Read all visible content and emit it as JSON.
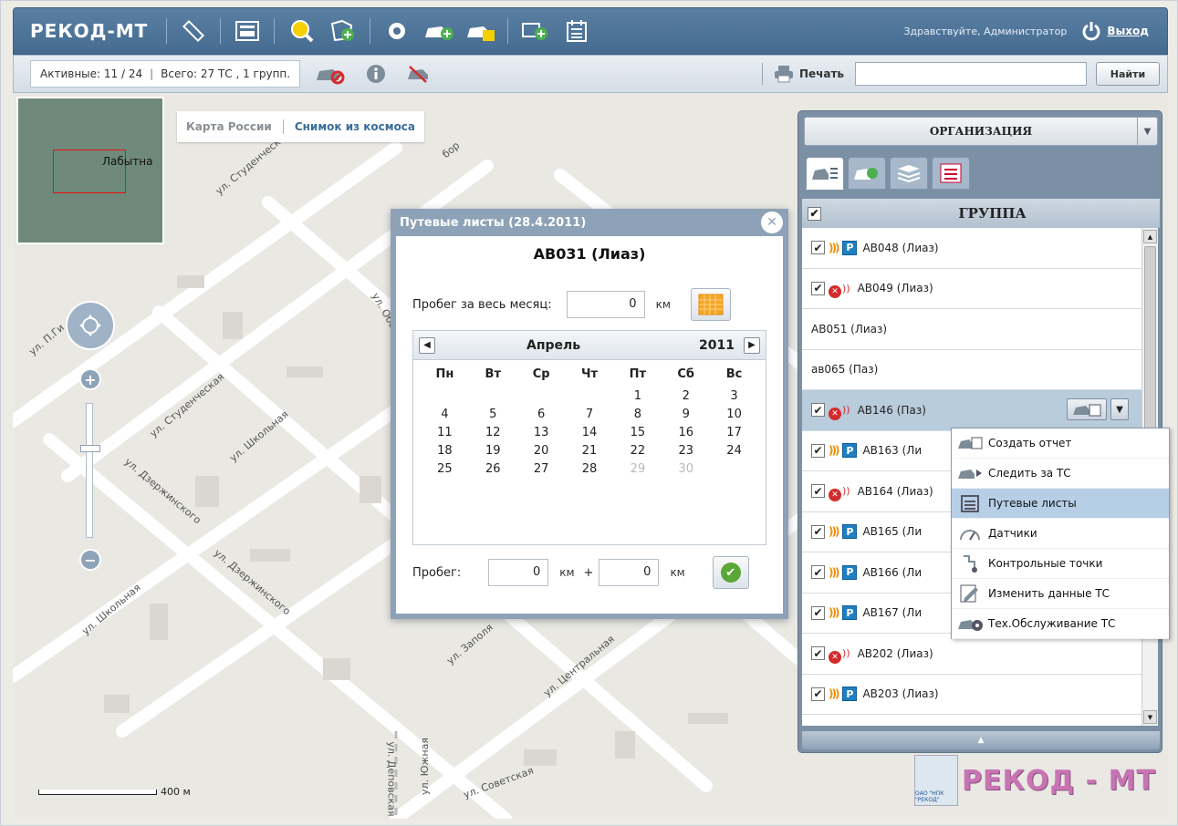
{
  "app": {
    "logo": "РЕКОД-МТ",
    "greeting": "Здравствуйте, Администратор",
    "exit_label": "Выход"
  },
  "topbar_icons": [
    "ruler-icon",
    "calculator-icon",
    "zoom-search-icon",
    "add-zone-icon",
    "gear-icon",
    "add-vehicle-icon",
    "vehicle-report-icon",
    "add-card-icon",
    "calendar-list-icon"
  ],
  "stats": {
    "active": "Активные: 11 / 24",
    "total": "Всего: 27 ТС , 1 групп."
  },
  "toolbar": {
    "print_label": "Печать",
    "search_value": "",
    "find_label": "Найти"
  },
  "map": {
    "tab_russia": "Карта России",
    "tab_space": "Снимок из космоса",
    "minimap_label": "Лабытна",
    "scale_label": "400 м",
    "streets": [
      "ул. Студенческая",
      "ул. Студенческая",
      "ул. Школьная",
      "ул. Дзержинского",
      "ул. Дзержинского",
      "ул. Школьная",
      "ул. П.Ги",
      "ул. Южная",
      "ул. Деповская",
      "ул. Советская",
      "ул. Центральная",
      "ул. Заполя",
      "ул. Обс",
      "бор"
    ]
  },
  "dialog": {
    "header": "Путевые листы (28.4.2011)",
    "vehicle": "АВ031 (Лиаз)",
    "month_label": "Пробег за весь месяц:",
    "month_value": "0",
    "unit": "км",
    "cal_month": "Апрель",
    "cal_year": "2011",
    "weekdays": [
      "Пн",
      "Вт",
      "Ср",
      "Чт",
      "Пт",
      "Сб",
      "Вс"
    ],
    "weeks": [
      [
        "",
        "",
        "",
        "",
        "1",
        "2",
        "3"
      ],
      [
        "4",
        "5",
        "6",
        "7",
        "8",
        "9",
        "10"
      ],
      [
        "11",
        "12",
        "13",
        "14",
        "15",
        "16",
        "17"
      ],
      [
        "18",
        "19",
        "20",
        "21",
        "22",
        "23",
        "24"
      ],
      [
        "25",
        "26",
        "27",
        "28",
        "29",
        "30",
        ""
      ]
    ],
    "disabled_days": [
      "29",
      "30"
    ],
    "mileage_label": "Пробег:",
    "mileage_value": "0",
    "mileage_extra": "0",
    "plus": "+"
  },
  "panel": {
    "org_label": "ОРГАНИЗАЦИЯ",
    "tabs": [
      "vehicle-list-icon",
      "vehicle-key-icon",
      "layers-icon",
      "checklist-icon"
    ],
    "group_label": "ГРУППА",
    "vehicles": [
      {
        "name": "АВ048 (Лиаз)",
        "cb": true,
        "status": "online",
        "parking": true
      },
      {
        "name": "АВ049 (Лиаз)",
        "cb": true,
        "status": "offline",
        "parking": false
      },
      {
        "name": "АВ051 (Лиаз)",
        "cb": false,
        "status": "none",
        "parking": false
      },
      {
        "name": "ав065 (Паз)",
        "cb": false,
        "status": "none",
        "parking": false
      },
      {
        "name": "АВ146 (Паз)",
        "cb": true,
        "status": "offline",
        "parking": false,
        "selected": true
      },
      {
        "name": "АВ163 (Ли",
        "cb": true,
        "status": "online",
        "parking": true
      },
      {
        "name": "АВ164 (Лиаз)",
        "cb": true,
        "status": "offline",
        "parking": false
      },
      {
        "name": "АВ165 (Ли",
        "cb": true,
        "status": "online",
        "parking": true
      },
      {
        "name": "АВ166 (Ли",
        "cb": true,
        "status": "online",
        "parking": true
      },
      {
        "name": "АВ167 (Ли",
        "cb": true,
        "status": "online",
        "parking": true
      },
      {
        "name": "АВ202 (Лиаз)",
        "cb": true,
        "status": "offline",
        "parking": false
      },
      {
        "name": "АВ203 (Лиаз)",
        "cb": true,
        "status": "online",
        "parking": true
      }
    ]
  },
  "context_menu": [
    {
      "label": "Создать отчет",
      "icon": "report-icon"
    },
    {
      "label": "Следить за ТС",
      "icon": "track-vehicle-icon"
    },
    {
      "label": "Путевые листы",
      "icon": "waybill-icon",
      "highlighted": true
    },
    {
      "label": "Датчики",
      "icon": "gauge-icon"
    },
    {
      "label": "Контрольные точки",
      "icon": "checkpoint-icon"
    },
    {
      "label": "Изменить данные ТС",
      "icon": "edit-icon"
    },
    {
      "label": "Тех.Обслуживание ТС",
      "icon": "service-icon"
    }
  ],
  "brand": {
    "text": "РЕКОД - МТ",
    "emblem_caption": "ОАО \"НПК \"РЕКОД\""
  },
  "colors": {
    "topbar": "#4d7399",
    "panel": "#7b90a4",
    "highlight": "#b6cfe6",
    "selected_row": "#b9ccdc",
    "parking": "#1f7fc1",
    "offline": "#d32b2b",
    "online": "#f08c00"
  }
}
